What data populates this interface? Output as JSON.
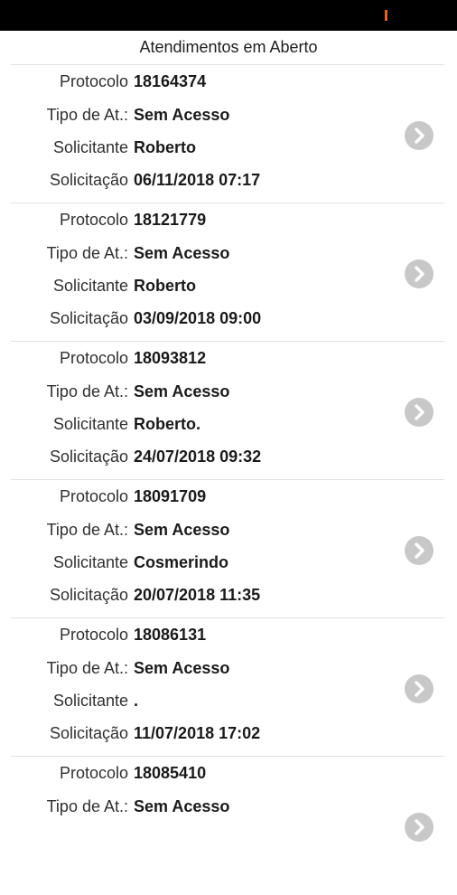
{
  "header": {
    "title": "Atendimentos em Aberto"
  },
  "labels": {
    "protocolo": "Protocolo",
    "tipo": "Tipo de At.:",
    "solicitante": "Solicitante",
    "solicitacao": "Solicitação"
  },
  "icons": {
    "chevron": "chevron-right-circle-icon"
  },
  "colors": {
    "status_bar": "#000000",
    "chevron_bg": "#c8c8c8",
    "divider": "#e2e2e2"
  },
  "items": [
    {
      "protocolo": "18164374",
      "tipo": "Sem Acesso",
      "solicitante": "Roberto",
      "solicitacao": "06/11/2018 07:17"
    },
    {
      "protocolo": "18121779",
      "tipo": "Sem Acesso",
      "solicitante": "Roberto",
      "solicitacao": "03/09/2018 09:00"
    },
    {
      "protocolo": "18093812",
      "tipo": "Sem Acesso",
      "solicitante": "Roberto.",
      "solicitacao": "24/07/2018 09:32"
    },
    {
      "protocolo": "18091709",
      "tipo": "Sem Acesso",
      "solicitante": "Cosmerindo",
      "solicitacao": "20/07/2018 11:35"
    },
    {
      "protocolo": "18086131",
      "tipo": "Sem Acesso",
      "solicitante": ".",
      "solicitacao": "11/07/2018 17:02"
    },
    {
      "protocolo": "18085410",
      "tipo": "Sem Acesso",
      "solicitante": "",
      "solicitacao": ""
    }
  ]
}
